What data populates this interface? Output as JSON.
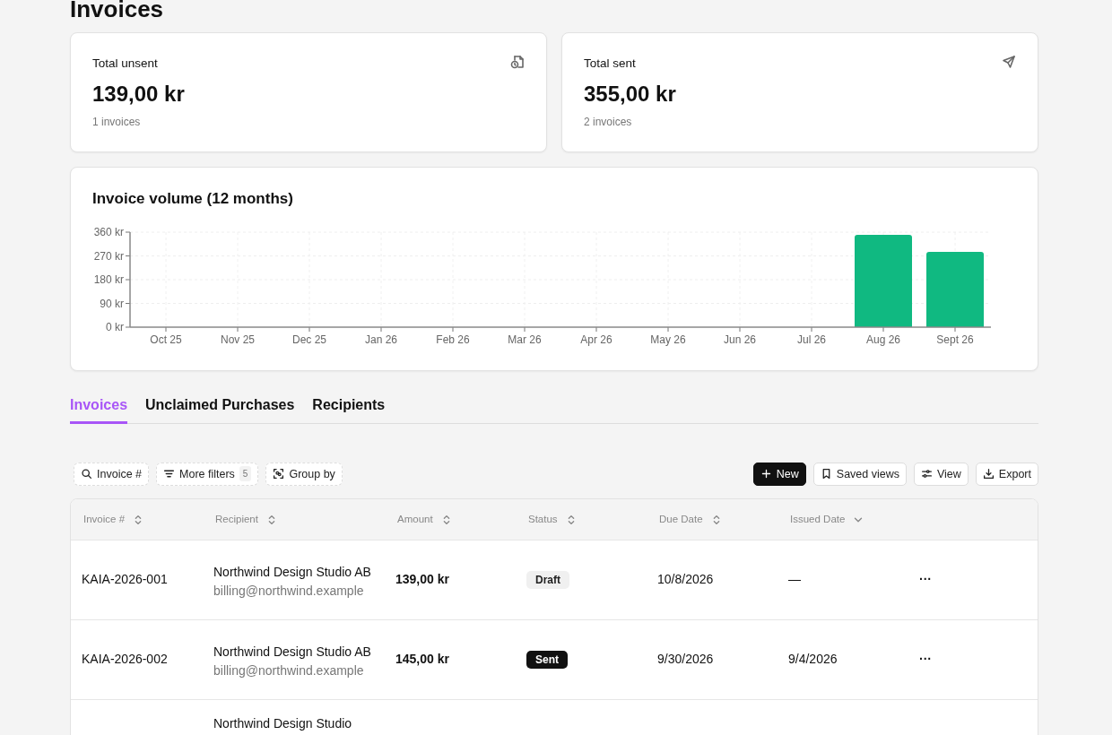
{
  "page_title": "Invoices",
  "summary_cards": [
    {
      "title": "Total unsent",
      "amount": "139,00 kr",
      "count": "1 invoices"
    },
    {
      "title": "Total sent",
      "amount": "355,00 kr",
      "count": "2 invoices"
    }
  ],
  "chart_card": {
    "title": "Invoice volume (12 months)",
    "chart_data": {
      "type": "bar",
      "categories": [
        "Oct 25",
        "Nov 25",
        "Dec 25",
        "Jan 26",
        "Feb 26",
        "Mar 26",
        "Apr 26",
        "May 26",
        "Jun 26",
        "Jul 26",
        "Aug 26",
        "Sept 26"
      ],
      "grid": true,
      "series": [
        {
          "color": "#10b981",
          "values": [
            0,
            0,
            0,
            0,
            0,
            0,
            0,
            0,
            0,
            0,
            350,
            285
          ]
        }
      ],
      "ylim": [
        0,
        360
      ],
      "yticks": [
        {
          "value": 0,
          "label": "0 kr"
        },
        {
          "value": 90,
          "label": "90 kr"
        },
        {
          "value": 180,
          "label": "180 kr"
        },
        {
          "value": 270,
          "label": "270 kr"
        },
        {
          "value": 360,
          "label": "360 kr"
        }
      ]
    }
  },
  "tabs": [
    {
      "label": "Invoices",
      "selected": true
    },
    {
      "label": "Unclaimed Purchases",
      "selected": false
    },
    {
      "label": "Recipients",
      "selected": false
    }
  ],
  "filters": [
    {
      "label": "Invoice #"
    },
    {
      "label": "More filters",
      "count": "5"
    },
    {
      "label": "Group by"
    }
  ],
  "actions": [
    {
      "label": "New",
      "primary": true
    },
    {
      "label": "Saved views",
      "primary": false
    },
    {
      "label": "View",
      "primary": false
    },
    {
      "label": "Export",
      "primary": false
    }
  ],
  "table": {
    "columns": [
      {
        "label": "Invoice #",
        "sorted": false
      },
      {
        "label": "Recipient",
        "sorted": false
      },
      {
        "label": "Amount",
        "sorted": false
      },
      {
        "label": "Status",
        "sorted": false
      },
      {
        "label": "Due Date",
        "sorted": false
      },
      {
        "label": "Issued Date",
        "sorted": true
      }
    ],
    "rows": [
      {
        "invoice": "KAIA-2026-001",
        "recipient_name": "Northwind Design Studio AB",
        "recipient_email": "billing@northwind.example",
        "amount": "139,00 kr",
        "status": "Draft",
        "kind": "draft",
        "due_date": "10/8/2026",
        "issued_date": "—",
        "menu": "···"
      },
      {
        "invoice": "KAIA-2026-002",
        "recipient_name": "Northwind Design Studio AB",
        "recipient_email": "billing@northwind.example",
        "amount": "145,00 kr",
        "status": "Sent",
        "kind": "sent",
        "due_date": "9/30/2026",
        "issued_date": "9/4/2026",
        "menu": "···"
      },
      {
        "recipient_name": "Northwind Design Studio"
      }
    ]
  }
}
